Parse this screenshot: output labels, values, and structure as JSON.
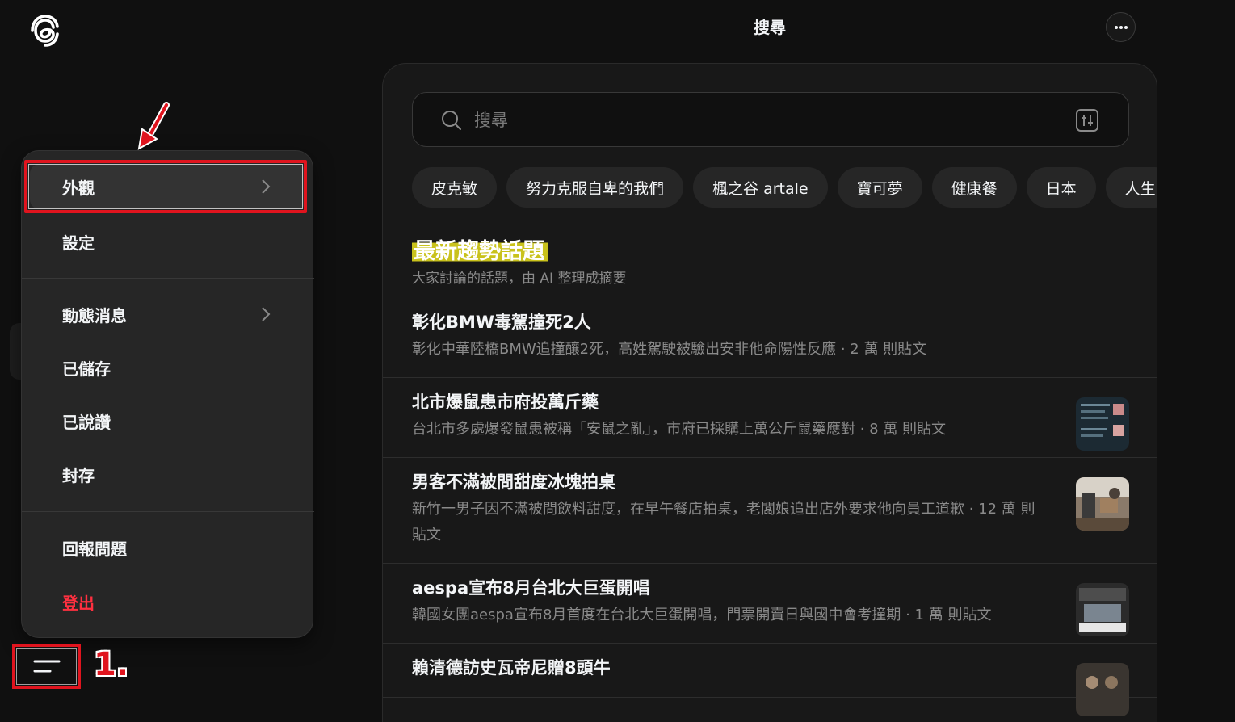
{
  "header": {
    "title": "搜尋",
    "logo_icon": "threads-logo-icon",
    "more_icon": "more-horizontal-icon"
  },
  "search": {
    "placeholder": "搜尋",
    "value": "",
    "search_icon": "search-icon",
    "filter_icon": "filter-icon"
  },
  "chips": [
    {
      "label": "皮克敏"
    },
    {
      "label": "努力克服自卑的我們"
    },
    {
      "label": "楓之谷 artale"
    },
    {
      "label": "寶可夢"
    },
    {
      "label": "健康餐"
    },
    {
      "label": "日本"
    },
    {
      "label": "人生"
    }
  ],
  "trending": {
    "title": "最新趨勢話題",
    "subtitle": "大家討論的話題，由 AI 整理成摘要",
    "items": [
      {
        "title": "彰化BMW毒駕撞死2人",
        "desc": "彰化中華陸橋BMW追撞釀2死，高姓駕駛被驗出安非他命陽性反應 · 2 萬 則貼文",
        "thumb": false
      },
      {
        "title": "北市爆鼠患市府投萬斤藥",
        "desc": "台北市多處爆發鼠患被稱「安鼠之亂」，市府已採購上萬公斤鼠藥應對 · 8 萬 則貼文",
        "thumb": true
      },
      {
        "title": "男客不滿被問甜度冰塊拍桌",
        "desc": "新竹一男子因不滿被問飲料甜度，在早午餐店拍桌，老闆娘追出店外要求他向員工道歉 · 12 萬 則貼文",
        "thumb": true
      },
      {
        "title": "aespa宣布8月台北大巨蛋開唱",
        "desc": "韓國女團aespa宣布8月首度在台北大巨蛋開唱，門票開賣日與國中會考撞期 · 1 萬 則貼文",
        "thumb": true
      },
      {
        "title": "賴清德訪史瓦帝尼贈8頭牛",
        "desc": "",
        "thumb": true
      }
    ]
  },
  "menu": {
    "items": [
      {
        "label": "外觀",
        "has_chevron": true,
        "active": true
      },
      {
        "label": "設定",
        "has_chevron": false
      },
      {
        "label": "動態消息",
        "has_chevron": true
      },
      {
        "label": "已儲存",
        "has_chevron": false
      },
      {
        "label": "已說讚",
        "has_chevron": false
      },
      {
        "label": "封存",
        "has_chevron": false
      },
      {
        "label": "回報問題",
        "has_chevron": false
      },
      {
        "label": "登出",
        "has_chevron": false,
        "danger": true
      }
    ],
    "chevron_icon": "chevron-right-icon",
    "hamburger_icon": "menu-icon"
  },
  "annotation": {
    "step_label": "1.",
    "arrow_icon": "annotation-arrow-icon"
  },
  "colors": {
    "background": "#101010",
    "panel": "#181818",
    "menu": "#262626",
    "danger": "#ff3040",
    "annotation_red": "#e0141e",
    "highlight": "#c9c21c"
  }
}
